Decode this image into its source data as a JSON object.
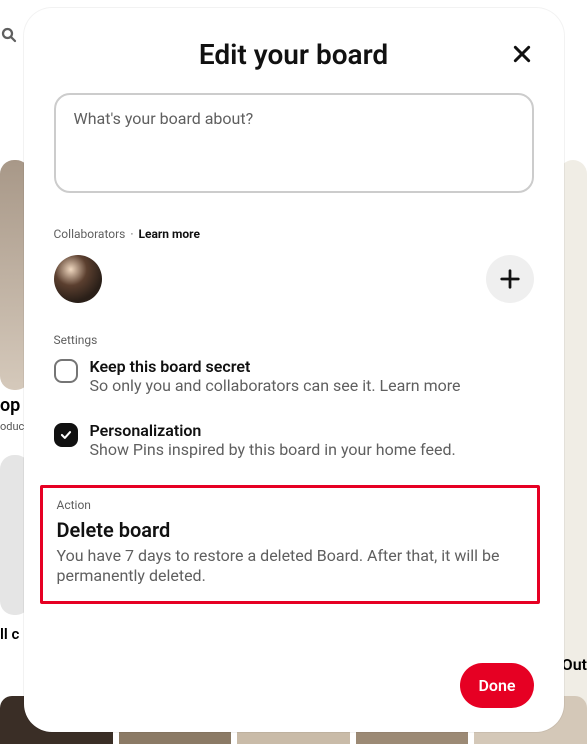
{
  "background": {
    "left_title": "op",
    "left_sub": "oduc",
    "left_bottom": "ll c",
    "right_text": "Out"
  },
  "modal": {
    "title": "Edit your board",
    "description_placeholder": "What's your board about?",
    "collaborators": {
      "label": "Collaborators",
      "separator": "·",
      "learn_more": "Learn more"
    },
    "settings": {
      "label": "Settings",
      "secret": {
        "title": "Keep this board secret",
        "desc": "So only you and collaborators can see it. ",
        "learn_more": "Learn more"
      },
      "personalization": {
        "title": "Personalization",
        "desc": "Show Pins inspired by this board in your home feed."
      }
    },
    "action": {
      "label": "Action",
      "title": "Delete board",
      "desc": "You have 7 days to restore a deleted Board. After that, it will be permanently deleted."
    },
    "done": "Done"
  }
}
